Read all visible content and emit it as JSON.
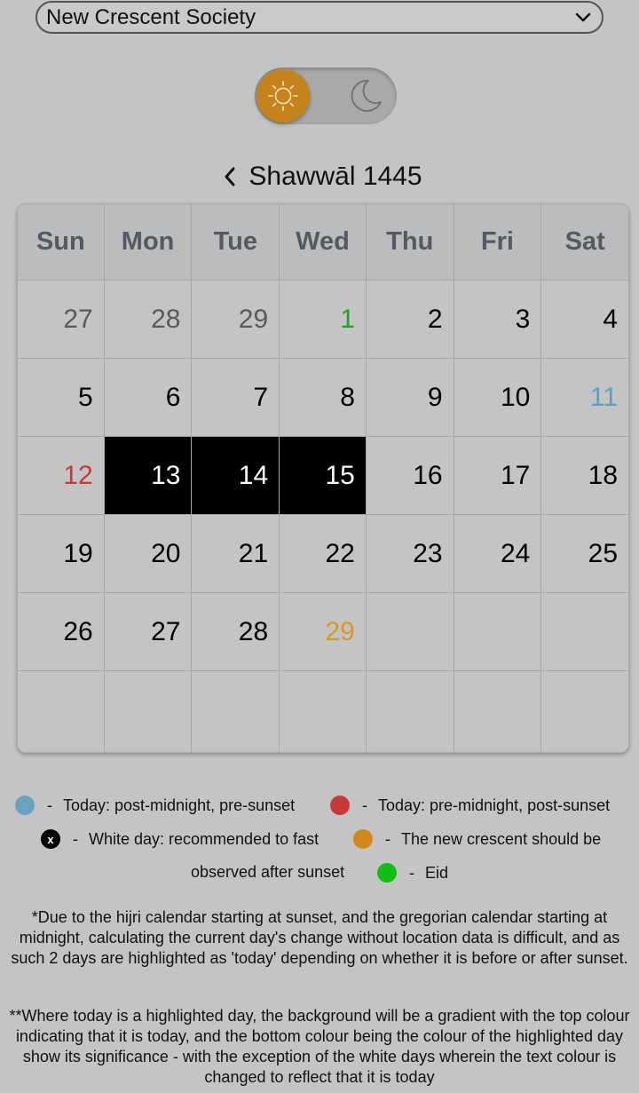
{
  "society_select": {
    "value": "New Crescent Society"
  },
  "theme_toggle": {
    "state": "light"
  },
  "calendar": {
    "month_title": "Shawwāl 1445",
    "day_names": [
      "Sun",
      "Mon",
      "Tue",
      "Wed",
      "Thu",
      "Fri",
      "Sat"
    ],
    "weeks": [
      [
        {
          "d": "27",
          "s": "muted"
        },
        {
          "d": "28",
          "s": "muted"
        },
        {
          "d": "29",
          "s": "muted"
        },
        {
          "d": "1",
          "s": "green"
        },
        {
          "d": "2",
          "s": ""
        },
        {
          "d": "3",
          "s": ""
        },
        {
          "d": "4",
          "s": ""
        }
      ],
      [
        {
          "d": "5",
          "s": ""
        },
        {
          "d": "6",
          "s": ""
        },
        {
          "d": "7",
          "s": ""
        },
        {
          "d": "8",
          "s": ""
        },
        {
          "d": "9",
          "s": ""
        },
        {
          "d": "10",
          "s": ""
        },
        {
          "d": "11",
          "s": "blue"
        }
      ],
      [
        {
          "d": "12",
          "s": "red"
        },
        {
          "d": "13",
          "s": "white-day"
        },
        {
          "d": "14",
          "s": "white-day"
        },
        {
          "d": "15",
          "s": "white-day"
        },
        {
          "d": "16",
          "s": ""
        },
        {
          "d": "17",
          "s": ""
        },
        {
          "d": "18",
          "s": ""
        }
      ],
      [
        {
          "d": "19",
          "s": ""
        },
        {
          "d": "20",
          "s": ""
        },
        {
          "d": "21",
          "s": ""
        },
        {
          "d": "22",
          "s": ""
        },
        {
          "d": "23",
          "s": ""
        },
        {
          "d": "24",
          "s": ""
        },
        {
          "d": "25",
          "s": ""
        }
      ],
      [
        {
          "d": "26",
          "s": ""
        },
        {
          "d": "27",
          "s": ""
        },
        {
          "d": "28",
          "s": ""
        },
        {
          "d": "29",
          "s": "orange"
        },
        {
          "d": "",
          "s": ""
        },
        {
          "d": "",
          "s": ""
        },
        {
          "d": "",
          "s": ""
        }
      ],
      [
        {
          "d": "",
          "s": ""
        },
        {
          "d": "",
          "s": ""
        },
        {
          "d": "",
          "s": ""
        },
        {
          "d": "",
          "s": ""
        },
        {
          "d": "",
          "s": ""
        },
        {
          "d": "",
          "s": ""
        },
        {
          "d": "",
          "s": ""
        }
      ]
    ]
  },
  "legend": {
    "separator": "-",
    "today_pre_sunset": "Today: post-midnight, pre-sunset",
    "today_post_sunset": "Today: pre-midnight, post-sunset",
    "white_day": "White day: recommended to fast",
    "white_day_marker": "x",
    "crescent_line1": "The new crescent should be",
    "crescent_line2": "observed after sunset",
    "eid": "Eid"
  },
  "colors": {
    "today_pre_sunset": "#6aa3c2",
    "today_post_sunset": "#c73838",
    "crescent": "#d3891a",
    "eid": "#10c010"
  },
  "notes": {
    "note1": "*Due to the hijri calendar starting at sunset, and the gregorian calendar starting at midnight, calculating the current day's change without location data is difficult, and as such 2 days are highlighted as 'today' depending on whether it is before or after sunset.",
    "note2": "**Where today is a highlighted day, the background will be a gradient with the top colour indicating that it is today, and the bottom colour being the colour of the highlighted day show its significance - with the exception of the white days wherein the text colour is changed to reflect that it is today"
  }
}
